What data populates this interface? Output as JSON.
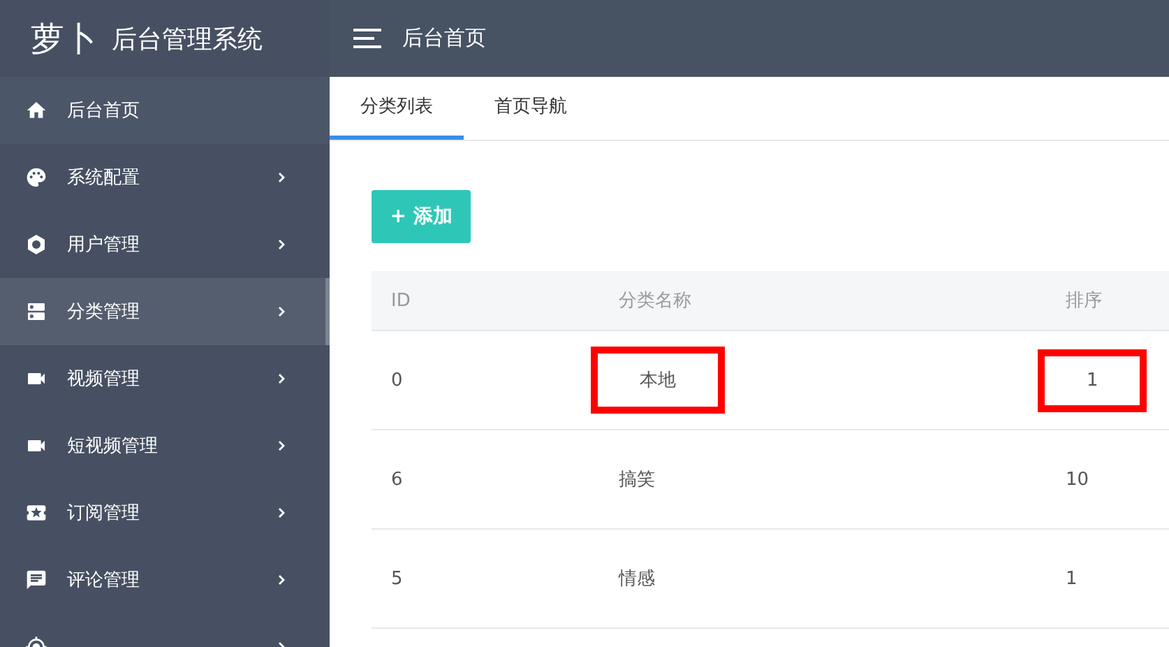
{
  "sidebar": {
    "logo": {
      "brand": "萝卜",
      "title": "后台管理系统"
    },
    "items": [
      {
        "kind": "home",
        "label": "后台首页",
        "selected": false,
        "has_arrow": false
      },
      {
        "kind": "palette",
        "label": "系统配置",
        "selected": false,
        "has_arrow": true
      },
      {
        "kind": "hexagon",
        "label": "用户管理",
        "selected": false,
        "has_arrow": true
      },
      {
        "kind": "stack",
        "label": "分类管理",
        "selected": true,
        "has_arrow": true
      },
      {
        "kind": "video",
        "label": "视频管理",
        "selected": false,
        "has_arrow": true
      },
      {
        "kind": "video",
        "label": "短视频管理",
        "selected": false,
        "has_arrow": true
      },
      {
        "kind": "ticket",
        "label": "订阅管理",
        "selected": false,
        "has_arrow": true
      },
      {
        "kind": "comment",
        "label": "评论管理",
        "selected": false,
        "has_arrow": true
      },
      {
        "kind": "target",
        "selected": false,
        "has_arrow": true
      }
    ]
  },
  "header": {
    "title": "后台首页"
  },
  "tabs": [
    {
      "label": "分类列表",
      "selected": true
    },
    {
      "label": "首页导航",
      "selected": false
    }
  ],
  "add_button": "+ 添加",
  "table": {
    "columns": [
      "ID",
      "分类名称",
      "排序"
    ],
    "rows": [
      [
        {
          "text": "0",
          "marked": false
        },
        {
          "text": "本地",
          "marked": true
        },
        {
          "text": "1",
          "marked": true
        }
      ],
      [
        {
          "text": "6",
          "marked": false
        },
        {
          "text": "搞笑",
          "marked": false
        },
        {
          "text": "10",
          "marked": false
        }
      ],
      [
        {
          "text": "5",
          "marked": false
        },
        {
          "text": "情感",
          "marked": false
        },
        {
          "text": "1",
          "marked": false
        }
      ]
    ]
  }
}
